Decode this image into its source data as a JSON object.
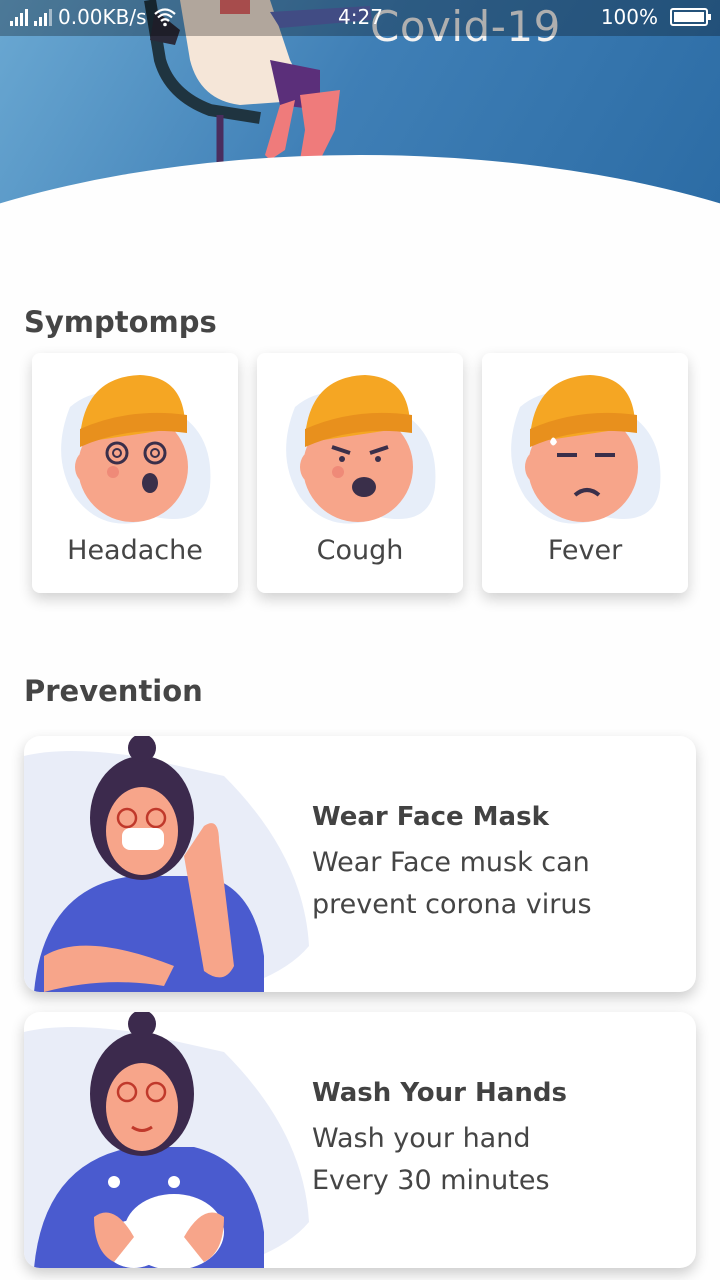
{
  "status_bar": {
    "network_speed": "0.00KB/s",
    "time": "4:27",
    "battery_percent": "100%",
    "battery_level": 1.0
  },
  "header": {
    "title": "Covid-19"
  },
  "symptoms": {
    "title": "Symptomps",
    "items": [
      {
        "label": "Headache"
      },
      {
        "label": "Cough"
      },
      {
        "label": "Fever"
      }
    ]
  },
  "prevention": {
    "title": "Prevention",
    "items": [
      {
        "title": "Wear Face Mask",
        "description": "Wear Face musk can\n prevent corona virus"
      },
      {
        "title": "Wash Your Hands",
        "description": "Wash your hand\n Every 30 minutes"
      }
    ]
  },
  "colors": {
    "header_gradient_start": "#6aa8d2",
    "header_gradient_end": "#2a6aa3",
    "hat": "#f5a623",
    "skin": "#f7a58a",
    "shirt": "#4a5bcf"
  }
}
